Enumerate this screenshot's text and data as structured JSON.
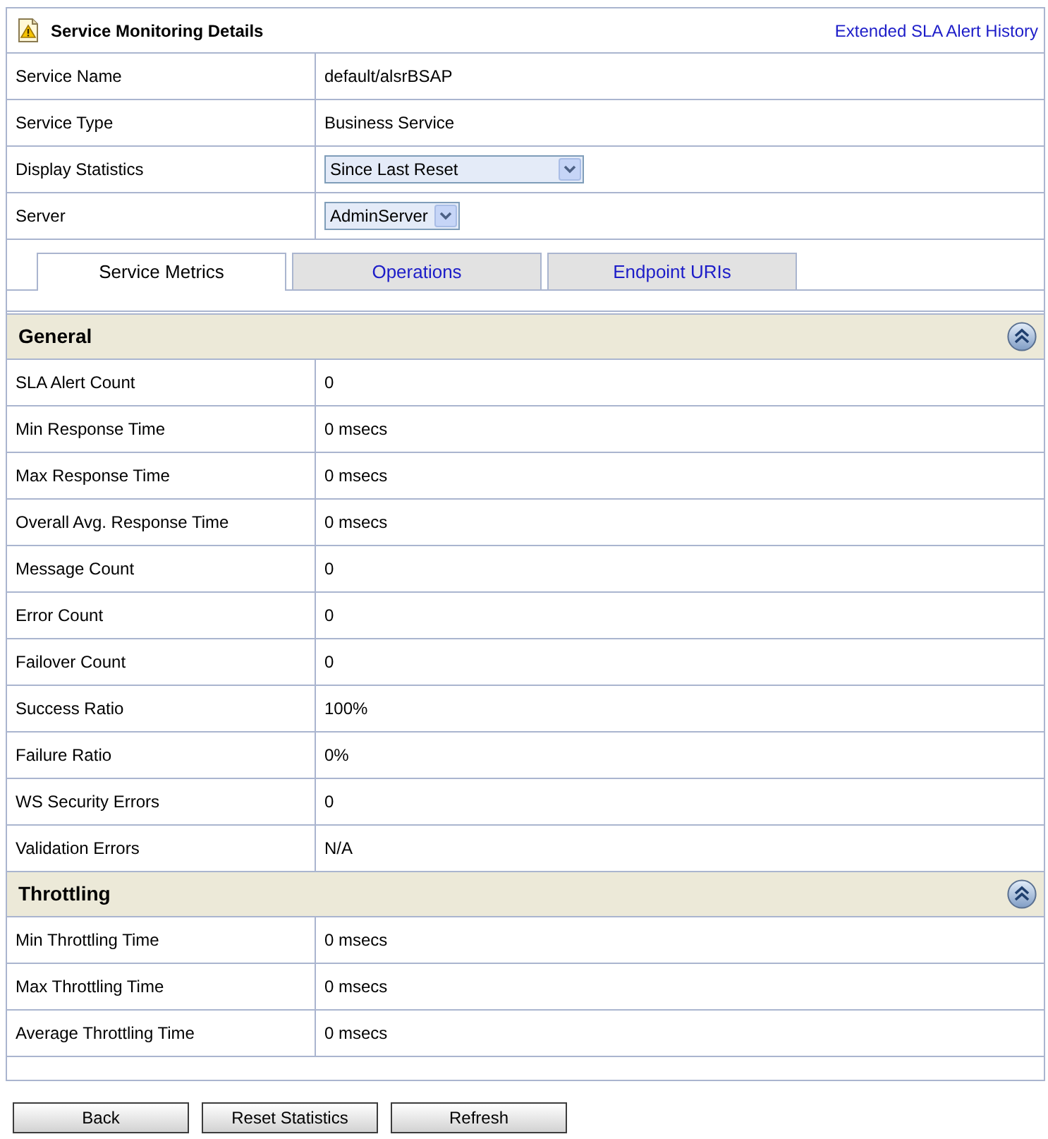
{
  "header": {
    "title": "Service Monitoring Details",
    "link": "Extended SLA Alert History"
  },
  "info_rows": [
    {
      "label": "Service Name",
      "kind": "text",
      "value": "default/alsrBSAP"
    },
    {
      "label": "Service Type",
      "kind": "text",
      "value": "Business Service"
    },
    {
      "label": "Display Statistics",
      "kind": "select",
      "value": "Since Last Reset"
    },
    {
      "label": "Server",
      "kind": "select",
      "value": "AdminServer"
    }
  ],
  "tabs": [
    {
      "label": "Service Metrics",
      "selected": true
    },
    {
      "label": "Operations",
      "selected": false
    },
    {
      "label": "Endpoint URIs",
      "selected": false
    }
  ],
  "sections": [
    {
      "title": "General",
      "expanded": true,
      "rows": [
        {
          "label": "SLA Alert Count",
          "value": "0"
        },
        {
          "label": "Min Response Time",
          "value": "0 msecs"
        },
        {
          "label": "Max Response Time",
          "value": "0 msecs"
        },
        {
          "label": "Overall Avg. Response Time",
          "value": "0 msecs"
        },
        {
          "label": "Message Count",
          "value": "0"
        },
        {
          "label": "Error Count",
          "value": "0"
        },
        {
          "label": "Failover Count",
          "value": "0"
        },
        {
          "label": "Success Ratio",
          "value": "100%"
        },
        {
          "label": "Failure Ratio",
          "value": "0%"
        },
        {
          "label": "WS Security Errors",
          "value": "0"
        },
        {
          "label": "Validation Errors",
          "value": "N/A"
        }
      ]
    },
    {
      "title": "Throttling",
      "expanded": true,
      "rows": [
        {
          "label": "Min Throttling Time",
          "value": "0 msecs"
        },
        {
          "label": "Max Throttling Time",
          "value": "0 msecs"
        },
        {
          "label": "Average Throttling Time",
          "value": "0 msecs"
        }
      ]
    }
  ],
  "buttons": [
    "Back",
    "Reset Statistics",
    "Refresh"
  ]
}
